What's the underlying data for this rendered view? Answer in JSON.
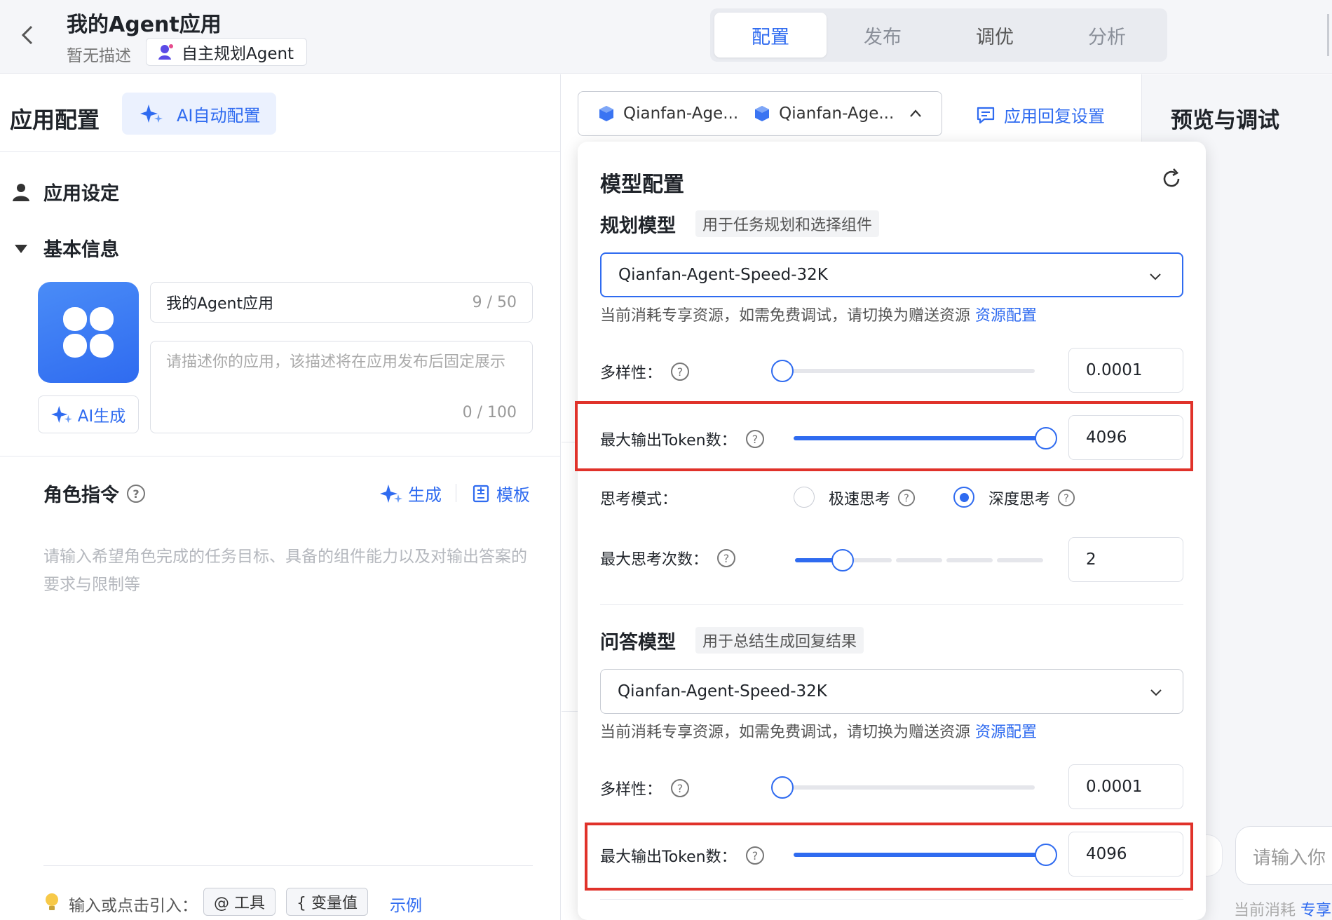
{
  "header": {
    "back_icon": "chevron-left-icon",
    "app_title": "我的Agent应用",
    "app_desc": "暂无描述",
    "agent_tag": "自主规划Agent",
    "tabs": [
      {
        "label": "配置",
        "state": "active"
      },
      {
        "label": "发布",
        "state": "disabled"
      },
      {
        "label": "调优",
        "state": "normal"
      },
      {
        "label": "分析",
        "state": "disabled"
      }
    ]
  },
  "toolbar": {
    "title": "应用配置",
    "ai_config": "AI自动配置",
    "model_chip_1": "Qianfan-Age...",
    "model_chip_2": "Qianfan-Age...",
    "reply_settings": "应用回复设置"
  },
  "left": {
    "app_settings": "应用设定",
    "basic_info": "基本信息",
    "ai_generate": "AI生成",
    "name_value": "我的Agent应用",
    "name_count": "9 / 50",
    "desc_placeholder": "请描述你的应用，该描述将在应用发布后固定展示",
    "desc_count": "0 / 100",
    "role_title": "角色指令",
    "generate": "生成",
    "template": "模板",
    "role_placeholder": "请输入希望角色完成的任务目标、具备的组件能力以及对输出答案的要求与限制等",
    "hint_label": "输入或点击引入：",
    "chip_tool": "@ 工具",
    "chip_var": "{ 变量值",
    "example": "示例"
  },
  "model_config": {
    "title": "模型配置",
    "planning": {
      "title": "规划模型",
      "tag": "用于任务规划和选择组件",
      "selected": "Qianfan-Agent-Speed-32K",
      "hint": "当前消耗专享资源，如需免费调试，请切换为赠送资源",
      "hint_link": "资源配置",
      "diversity_label": "多样性：",
      "diversity_value": "0.0001",
      "diversity_fraction": 0,
      "max_tokens_label": "最大输出Token数：",
      "max_tokens_value": "4096",
      "max_tokens_fraction": 1,
      "think_mode_label": "思考模式：",
      "think_fast": "极速思考",
      "think_deep": "深度思考",
      "think_selected": "深度思考",
      "max_think_label": "最大思考次数：",
      "max_think_value": "2"
    },
    "qa": {
      "title": "问答模型",
      "tag": "用于总结生成回复结果",
      "selected": "Qianfan-Agent-Speed-32K",
      "hint": "当前消耗专享资源，如需免费调试，请切换为赠送资源",
      "hint_link": "资源配置",
      "diversity_label": "多样性：",
      "diversity_value": "0.0001",
      "diversity_fraction": 0,
      "max_tokens_label": "最大输出Token数：",
      "max_tokens_value": "4096",
      "max_tokens_fraction": 1
    }
  },
  "preview": {
    "title": "预览与调试",
    "input_placeholder": "请输入你",
    "consume_text": "当前消耗",
    "consume_link": "专享"
  },
  "colors": {
    "accent": "#2f6bf0",
    "highlight": "#e0322a"
  }
}
